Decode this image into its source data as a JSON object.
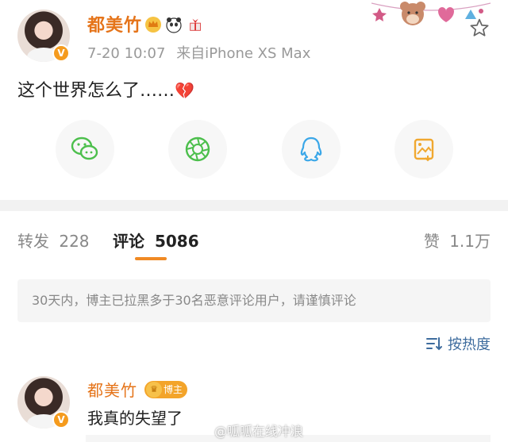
{
  "post": {
    "username": "都美竹",
    "verified_mark": "V",
    "time": "7-20 10:07",
    "source": "来自iPhone XS Max",
    "content_text": "这个世界怎么了……",
    "content_emoji": "💔",
    "badges": [
      "crown-badge",
      "panda-badge",
      "gift-badge"
    ]
  },
  "share": {
    "icons": [
      "wechat-icon",
      "moments-icon",
      "qq-icon",
      "save-image-icon"
    ]
  },
  "tabs": {
    "repost_label": "转发",
    "repost_count": "228",
    "comment_label": "评论",
    "comment_count": "5086",
    "like_label": "赞",
    "like_count": "1.1万"
  },
  "notice": {
    "text": "30天内，博主已拉黑多于30名恶意评论用户，请谨慎评论"
  },
  "sort": {
    "label": "按热度"
  },
  "comment": {
    "username": "都美竹",
    "badge_label": "博主",
    "text": "我真的失望了"
  },
  "watermark": {
    "text": "@呱呱在线冲浪"
  },
  "colors": {
    "username": "#e5741a",
    "accent": "#f08a24",
    "link": "#3e6c9e",
    "wechat": "#4cbf4c",
    "moments": "#4cbf4c",
    "qq": "#3ba7e8",
    "save": "#f0a830"
  }
}
